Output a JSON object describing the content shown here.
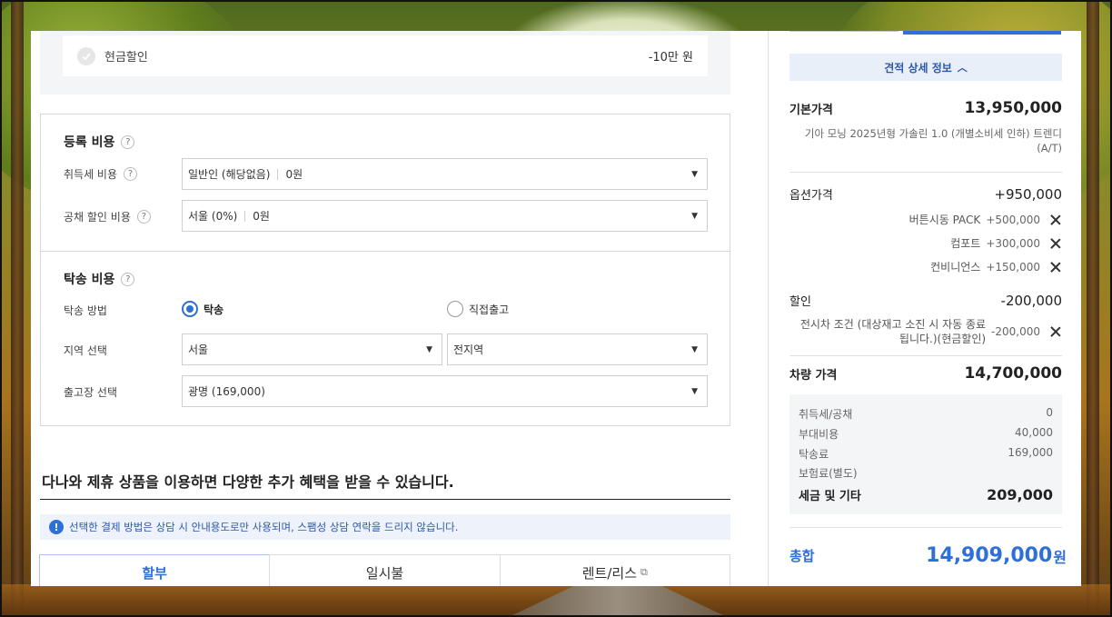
{
  "discount": {
    "label": "현금할인",
    "value": "-10만 원"
  },
  "registration": {
    "title": "등록 비용",
    "rows": [
      {
        "label": "취득세 비용",
        "select_main": "일반인 (해당없음)",
        "select_sub": "0원"
      },
      {
        "label": "공채 할인 비용",
        "select_main": "서울 (0%)",
        "select_sub": "0원"
      }
    ]
  },
  "delivery": {
    "title": "탁송 비용",
    "method_label": "탁송 방법",
    "options": [
      {
        "label": "탁송",
        "selected": true
      },
      {
        "label": "직접출고",
        "selected": false
      }
    ],
    "region_label": "지역 선택",
    "region_value": "서울",
    "region_sub_value": "전지역",
    "factory_label": "출고장 선택",
    "factory_value": "광명 (169,000)"
  },
  "promo": {
    "title": "다나와 제휴 상품을 이용하면 다양한 추가 혜택을 받을 수 있습니다.",
    "notice": "선택한 결제 방법은 상담 시 안내용도로만 사용되며, 스팸성 상담 연락을 드리지 않습니다.",
    "tabs": [
      {
        "label": "할부",
        "active": true
      },
      {
        "label": "일시불",
        "active": false
      },
      {
        "label": "렌트/리스",
        "active": false
      }
    ]
  },
  "summary": {
    "detail_toggle": "견적 상세 정보",
    "base_price_label": "기본가격",
    "base_price": "13,950,000",
    "base_desc": "기아 모닝 2025년형 가솔린 1.0 (개별소비세 인하) 트렌디 (A/T)",
    "option_label": "옵션가격",
    "option_total": "+950,000",
    "options": [
      {
        "name": "버튼시동 PACK",
        "price": "+500,000"
      },
      {
        "name": "컴포트",
        "price": "+300,000"
      },
      {
        "name": "컨비니언스",
        "price": "+150,000"
      }
    ],
    "discount_label": "할인",
    "discount_total": "-200,000",
    "discount_item_name": "전시차 조건 (대상재고 소진 시 자동 종료됩니다.)(현금할인)",
    "discount_item_price": "-200,000",
    "car_price_label": "차량 가격",
    "car_price": "14,700,000",
    "taxes": [
      {
        "label": "취득세/공채",
        "value": "0"
      },
      {
        "label": "부대비용",
        "value": "40,000"
      },
      {
        "label": "탁송료",
        "value": "169,000"
      },
      {
        "label": "보험료(별도)",
        "value": ""
      }
    ],
    "tax_total_label": "세금 및 기타",
    "tax_total": "209,000",
    "total_label": "총합",
    "total": "14,909,000",
    "total_unit": "원"
  },
  "colors": {
    "accent": "#2e6fd8",
    "notice_bg": "#eef3fb"
  }
}
